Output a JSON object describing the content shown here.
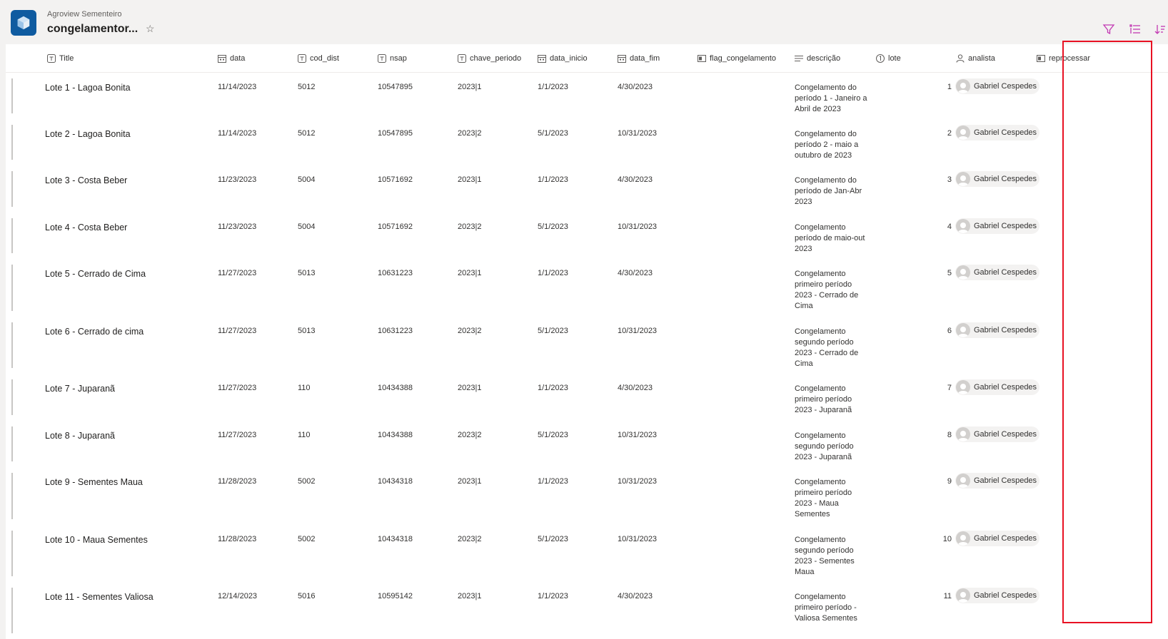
{
  "header": {
    "site_name": "Agroview Sementeiro",
    "list_title": "congelamentor...",
    "star_glyph": "☆"
  },
  "columns": [
    {
      "key": "title",
      "label": "Title",
      "icon": "text-field-icon"
    },
    {
      "key": "data",
      "label": "data",
      "icon": "calendar-icon"
    },
    {
      "key": "cod_dist",
      "label": "cod_dist",
      "icon": "text-field-icon"
    },
    {
      "key": "nsap",
      "label": "nsap",
      "icon": "text-field-icon"
    },
    {
      "key": "chave_periodo",
      "label": "chave_periodo",
      "icon": "text-field-icon"
    },
    {
      "key": "data_inicio",
      "label": "data_inicio",
      "icon": "calendar-icon"
    },
    {
      "key": "data_fim",
      "label": "data_fim",
      "icon": "calendar-icon"
    },
    {
      "key": "flag_congelamento",
      "label": "flag_congelamento",
      "icon": "yes-no-icon"
    },
    {
      "key": "descricao",
      "label": "descrição",
      "icon": "multiline-text-icon"
    },
    {
      "key": "lote",
      "label": "lote",
      "icon": "number-icon"
    },
    {
      "key": "analista",
      "label": "analista",
      "icon": "person-icon"
    },
    {
      "key": "reprocessar",
      "label": "reprocessar",
      "icon": "yes-no-icon"
    }
  ],
  "rows": [
    {
      "title": "Lote 1 - Lagoa Bonita",
      "data": "11/14/2023",
      "cod_dist": "5012",
      "nsap": "10547895",
      "chave_periodo": "2023|1",
      "data_inicio": "1/1/2023",
      "data_fim": "4/30/2023",
      "descricao": "Congelamento do período 1 - Janeiro a Abril de 2023",
      "lote": "1",
      "analista": "Gabriel Cespedes"
    },
    {
      "title": "Lote 2 - Lagoa Bonita",
      "data": "11/14/2023",
      "cod_dist": "5012",
      "nsap": "10547895",
      "chave_periodo": "2023|2",
      "data_inicio": "5/1/2023",
      "data_fim": "10/31/2023",
      "descricao": "Congelamento do período 2 - maio a outubro de 2023",
      "lote": "2",
      "analista": "Gabriel Cespedes"
    },
    {
      "title": "Lote 3 - Costa Beber",
      "data": "11/23/2023",
      "cod_dist": "5004",
      "nsap": "10571692",
      "chave_periodo": "2023|1",
      "data_inicio": "1/1/2023",
      "data_fim": "4/30/2023",
      "descricao": "Congelamento do período de Jan-Abr 2023",
      "lote": "3",
      "analista": "Gabriel Cespedes"
    },
    {
      "title": "Lote 4 - Costa Beber",
      "data": "11/23/2023",
      "cod_dist": "5004",
      "nsap": "10571692",
      "chave_periodo": "2023|2",
      "data_inicio": "5/1/2023",
      "data_fim": "10/31/2023",
      "descricao": "Congelamento período de maio-out 2023",
      "lote": "4",
      "analista": "Gabriel Cespedes"
    },
    {
      "title": "Lote 5 - Cerrado de Cima",
      "data": "11/27/2023",
      "cod_dist": "5013",
      "nsap": "10631223",
      "chave_periodo": "2023|1",
      "data_inicio": "1/1/2023",
      "data_fim": "4/30/2023",
      "descricao": "Congelamento primeiro período 2023 - Cerrado de Cima",
      "lote": "5",
      "analista": "Gabriel Cespedes"
    },
    {
      "title": "Lote 6 - Cerrado de cima",
      "data": "11/27/2023",
      "cod_dist": "5013",
      "nsap": "10631223",
      "chave_periodo": "2023|2",
      "data_inicio": "5/1/2023",
      "data_fim": "10/31/2023",
      "descricao": "Congelamento segundo período 2023 - Cerrado de Cima",
      "lote": "6",
      "analista": "Gabriel Cespedes"
    },
    {
      "title": "Lote 7 - Juparanã",
      "data": "11/27/2023",
      "cod_dist": "110",
      "nsap": "10434388",
      "chave_periodo": "2023|1",
      "data_inicio": "1/1/2023",
      "data_fim": "4/30/2023",
      "descricao": "Congelamento primeiro período 2023 - Juparanã",
      "lote": "7",
      "analista": "Gabriel Cespedes"
    },
    {
      "title": "Lote 8 - Juparanã",
      "data": "11/27/2023",
      "cod_dist": "110",
      "nsap": "10434388",
      "chave_periodo": "2023|2",
      "data_inicio": "5/1/2023",
      "data_fim": "10/31/2023",
      "descricao": "Congelamento segundo período 2023 - Juparanã",
      "lote": "8",
      "analista": "Gabriel Cespedes"
    },
    {
      "title": "Lote 9 - Sementes Maua",
      "data": "11/28/2023",
      "cod_dist": "5002",
      "nsap": "10434318",
      "chave_periodo": "2023|1",
      "data_inicio": "1/1/2023",
      "data_fim": "10/31/2023",
      "descricao": "Congelamento primeiro período 2023 - Maua Sementes",
      "lote": "9",
      "analista": "Gabriel Cespedes"
    },
    {
      "title": "Lote 10 - Maua Sementes",
      "data": "11/28/2023",
      "cod_dist": "5002",
      "nsap": "10434318",
      "chave_periodo": "2023|2",
      "data_inicio": "5/1/2023",
      "data_fim": "10/31/2023",
      "descricao": "Congelamento segundo período 2023 - Sementes Maua",
      "lote": "10",
      "analista": "Gabriel Cespedes"
    },
    {
      "title": "Lote 11 - Sementes Valiosa",
      "data": "12/14/2023",
      "cod_dist": "5016",
      "nsap": "10595142",
      "chave_periodo": "2023|1",
      "data_inicio": "1/1/2023",
      "data_fim": "4/30/2023",
      "descricao": "Congelamento primeiro período - Valiosa Sementes",
      "lote": "11",
      "analista": "Gabriel Cespedes"
    }
  ],
  "colors": {
    "accent": "#0f5ba0",
    "highlight": "#e81123",
    "command_icon": "#c239b3"
  }
}
